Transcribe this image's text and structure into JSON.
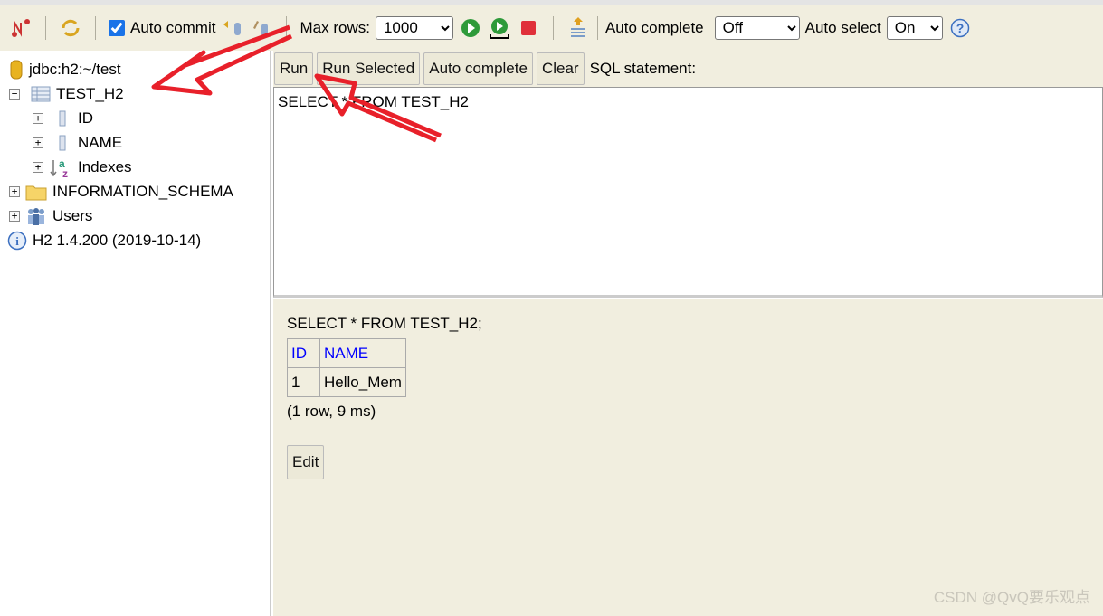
{
  "toolbar": {
    "auto_commit_label": "Auto commit",
    "auto_commit_checked": true,
    "max_rows_label": "Max rows:",
    "max_rows_value": "1000",
    "auto_complete_label": "Auto complete",
    "auto_complete_value": "Off",
    "auto_select_label": "Auto select",
    "auto_select_value": "On"
  },
  "tree": {
    "connection": "jdbc:h2:~/test",
    "table": "TEST_H2",
    "columns": [
      "ID",
      "NAME"
    ],
    "indexes": "Indexes",
    "schema": "INFORMATION_SCHEMA",
    "users": "Users",
    "version": "H2 1.4.200 (2019-10-14)"
  },
  "sqlbar": {
    "run": "Run",
    "run_selected": "Run Selected",
    "auto_complete": "Auto complete",
    "clear": "Clear",
    "label": "SQL statement:"
  },
  "editor": {
    "text": "SELECT * FROM TEST_H2"
  },
  "result": {
    "statement": "SELECT * FROM TEST_H2;",
    "headers": [
      "ID",
      "NAME"
    ],
    "rows": [
      [
        "1",
        "Hello_Mem"
      ]
    ],
    "summary": "(1 row, 9 ms)",
    "edit": "Edit"
  },
  "watermark": "CSDN @QvQ要乐观点",
  "colors": {
    "toolbar_bg": "#f1eedf",
    "header_link": "#0000ff",
    "annotation_arrow": "#e8202a"
  }
}
